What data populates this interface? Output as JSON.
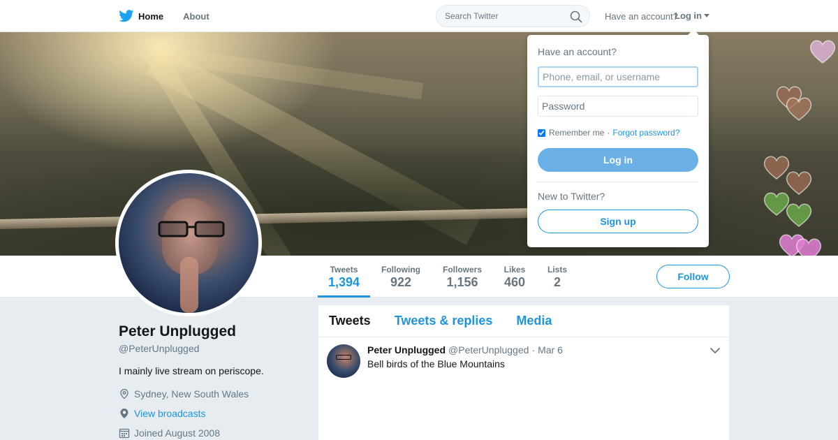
{
  "nav": {
    "home_label": "Home",
    "about_label": "About",
    "search_placeholder": "Search Twitter",
    "have_account": "Have an account?",
    "login_label": "Log in"
  },
  "login_dropdown": {
    "title": "Have an account?",
    "username_placeholder": "Phone, email, or username",
    "password_placeholder": "Password",
    "remember_label": "Remember me",
    "separator": "·",
    "forgot_label": "Forgot password?",
    "login_button": "Log in",
    "new_label": "New to Twitter?",
    "signup_button": "Sign up"
  },
  "stats": [
    {
      "label": "Tweets",
      "value": "1,394"
    },
    {
      "label": "Following",
      "value": "922"
    },
    {
      "label": "Followers",
      "value": "1,156"
    },
    {
      "label": "Likes",
      "value": "460"
    },
    {
      "label": "Lists",
      "value": "2"
    }
  ],
  "follow_button": "Follow",
  "profile": {
    "name": "Peter Unplugged",
    "handle": "@PeterUnplugged",
    "bio": "I mainly live stream on periscope.",
    "location": "Sydney, New South Wales",
    "broadcasts_link": "View broadcasts",
    "joined": "Joined August 2008"
  },
  "timeline": {
    "tabs": [
      "Tweets",
      "Tweets & replies",
      "Media"
    ],
    "tweets": [
      {
        "name": "Peter Unplugged",
        "handle": "@PeterUnplugged",
        "separator": "·",
        "date": "Mar 6",
        "text": "Bell birds of the Blue Mountains"
      }
    ]
  },
  "colors": {
    "brand_blue": "#1b95e0",
    "login_button": "#6ab0e6",
    "page_bg": "#e6ecf0"
  }
}
